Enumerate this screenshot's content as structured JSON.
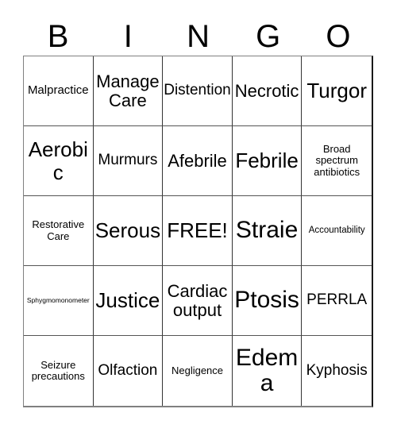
{
  "card": {
    "title_letters": [
      "B",
      "I",
      "N",
      "G",
      "O"
    ],
    "free_space_label": "FREE!",
    "grid_line_color": "#333333",
    "text_color": "#000000",
    "background_color": "#ffffff",
    "rows": [
      [
        {
          "text": "Malpractice",
          "size": "fs-s"
        },
        {
          "text": "Manage Care",
          "size": "fs-l"
        },
        {
          "text": "Distention",
          "size": "fs-m"
        },
        {
          "text": "Necrotic",
          "size": "fs-l"
        },
        {
          "text": "Turgor",
          "size": "fs-xl"
        }
      ],
      [
        {
          "text": "Aerobic",
          "size": "fs-xl"
        },
        {
          "text": "Murmurs",
          "size": "fs-m"
        },
        {
          "text": "Afebrile",
          "size": "fs-l"
        },
        {
          "text": "Febrile",
          "size": "fs-xl"
        },
        {
          "text": "Broad spectrum antibiotics",
          "size": "fs-xs"
        }
      ],
      [
        {
          "text": "Restorative Care",
          "size": "fs-xs"
        },
        {
          "text": "Serous",
          "size": "fs-xl"
        },
        {
          "text": "FREE!",
          "size": "fs-xl"
        },
        {
          "text": "Straie",
          "size": "fs-xxl"
        },
        {
          "text": "Accountability",
          "size": "fs-xxs"
        }
      ],
      [
        {
          "text": "Sphygmomonometer",
          "size": "fs-tiny"
        },
        {
          "text": "Justice",
          "size": "fs-xl"
        },
        {
          "text": "Cardiac output",
          "size": "fs-l"
        },
        {
          "text": "Ptosis",
          "size": "fs-xxl"
        },
        {
          "text": "PERRLA",
          "size": "fs-m"
        }
      ],
      [
        {
          "text": "Seizure precautions",
          "size": "fs-xs"
        },
        {
          "text": "Olfaction",
          "size": "fs-m"
        },
        {
          "text": "Negligence",
          "size": "fs-xs"
        },
        {
          "text": "Edema",
          "size": "fs-xxl"
        },
        {
          "text": "Kyphosis",
          "size": "fs-m"
        }
      ]
    ]
  }
}
